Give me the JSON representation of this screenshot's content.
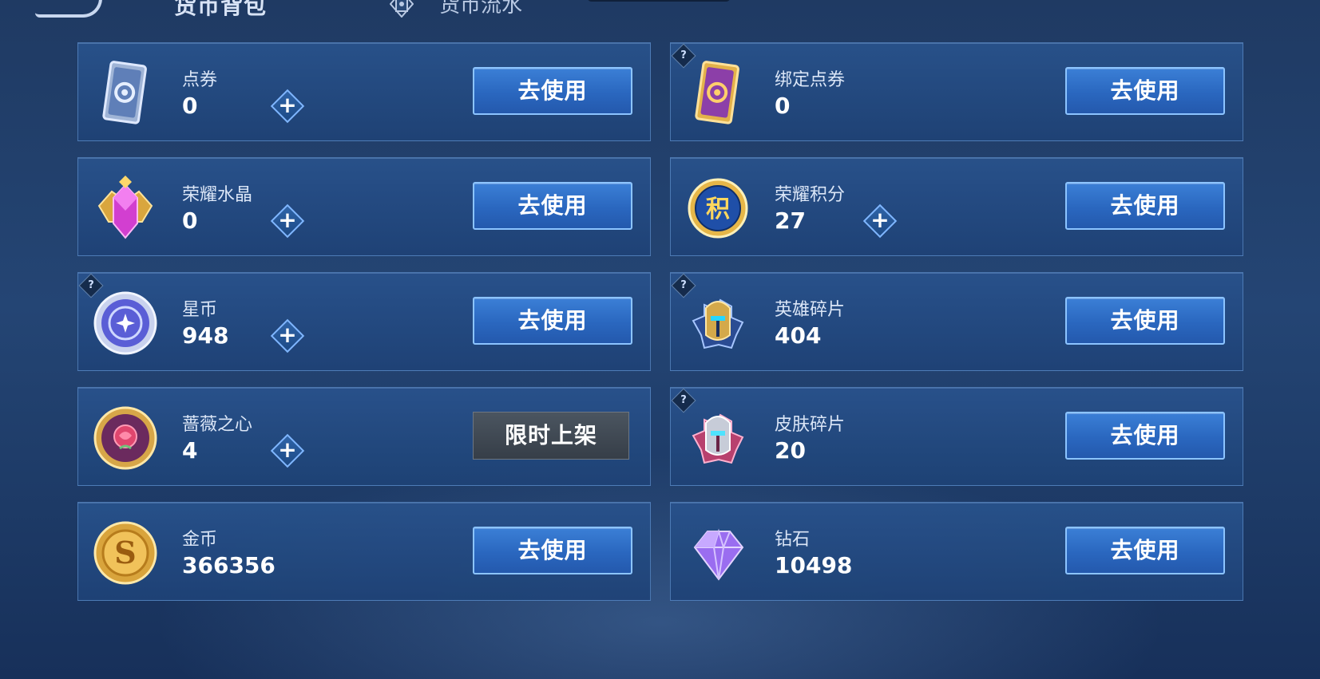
{
  "header": {
    "title": "货币背包",
    "flow_tab": "货币流水"
  },
  "use_label": "去使用",
  "limited_label": "限时上架",
  "help_mark": "?",
  "plus_mark": "+",
  "currencies": [
    {
      "name": "点券",
      "value": "0",
      "icon": "voucher-icon"
    },
    {
      "name": "绑定点券",
      "value": "0",
      "icon": "bound-voucher-icon"
    },
    {
      "name": "荣耀水晶",
      "value": "0",
      "icon": "glory-crystal-icon"
    },
    {
      "name": "荣耀积分",
      "value": "27",
      "icon": "glory-points-icon",
      "icon_text": "积"
    },
    {
      "name": "星币",
      "value": "948",
      "icon": "star-coin-icon"
    },
    {
      "name": "英雄碎片",
      "value": "404",
      "icon": "hero-shard-icon"
    },
    {
      "name": "蔷薇之心",
      "value": "4",
      "icon": "rose-heart-icon"
    },
    {
      "name": "皮肤碎片",
      "value": "20",
      "icon": "skin-shard-icon"
    },
    {
      "name": "金币",
      "value": "366356",
      "icon": "gold-coin-icon",
      "icon_text": "S"
    },
    {
      "name": "钻石",
      "value": "10498",
      "icon": "diamond-icon"
    }
  ]
}
